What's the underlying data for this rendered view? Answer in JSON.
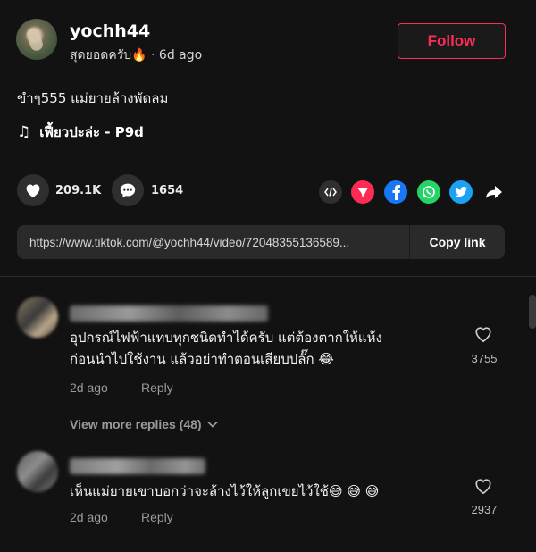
{
  "author": {
    "username": "yochh44",
    "nickname": "สุดยอดครับ🔥",
    "separator": "·",
    "time_ago": "6d ago",
    "follow_label": "Follow"
  },
  "post": {
    "caption": "ขำๆ555 แม่ยายล้างพัดลม",
    "music_icon": "♫",
    "music": "เฟี้ยวปะล่ะ - P9d"
  },
  "stats": {
    "likes": "209.1K",
    "comments": "1654"
  },
  "share": {
    "icons": [
      "embed-icon",
      "send-icon",
      "facebook-icon",
      "whatsapp-icon",
      "twitter-icon",
      "share-arrow-icon"
    ],
    "colors": {
      "send": "#fe2c55",
      "facebook": "#1877f2",
      "whatsapp": "#25d366",
      "twitter": "#1da1f2"
    }
  },
  "link": {
    "url": "https://www.tiktok.com/@yochh44/video/72048355136589...",
    "copy_label": "Copy link"
  },
  "comments": [
    {
      "text_line1": "อุปกรณ์ไฟฟ้าแทบทุกชนิดทำได้ครับ แต่ต้องตากให้แห้ง",
      "text_line2": "ก่อนนำไปใช้งาน แล้วอย่าทำตอนเสียบปลั๊ก 😂",
      "time": "2d ago",
      "reply_label": "Reply",
      "likes": "3755",
      "view_more": "View more replies (48)"
    },
    {
      "text_line1": "เห็นแม่ยายเขาบอกว่าจะล้างไว้ให้ลูกเขยไว้ใช้😅 😅 😅",
      "time": "2d ago",
      "reply_label": "Reply",
      "likes": "2937"
    }
  ],
  "theme": {
    "background": "#121212",
    "accent": "#fe2c55"
  }
}
